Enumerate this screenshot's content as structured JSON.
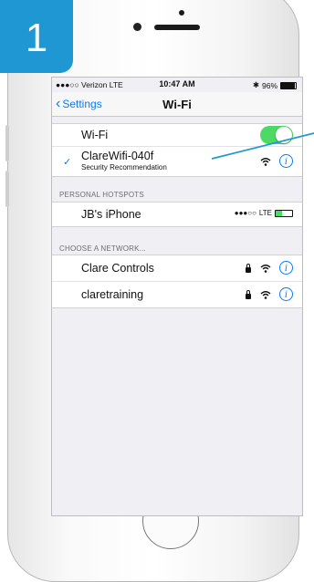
{
  "callout": {
    "step_number": "1",
    "color": "#1f97d3"
  },
  "status_bar": {
    "carrier": "●●●○○ Verizon  LTE",
    "time": "10:47 AM",
    "bluetooth": "✱",
    "battery": "96%"
  },
  "nav": {
    "back_label": "Settings",
    "title": "Wi-Fi"
  },
  "wifi_toggle": {
    "label": "Wi-Fi",
    "on": true
  },
  "connected_network": {
    "name": "ClareWifi-040f",
    "subtitle": "Security Recommendation"
  },
  "personal_hotspots": {
    "header": "PERSONAL HOTSPOTS",
    "items": [
      {
        "name": "JB's iPhone",
        "signal": "●●●○○",
        "network": "LTE"
      }
    ]
  },
  "choose_network": {
    "header": "CHOOSE A NETWORK...",
    "items": [
      {
        "name": "Clare Controls"
      },
      {
        "name": "claretraining"
      }
    ]
  },
  "icons": {
    "info": "i",
    "check": "✓",
    "wifi": "wifi-icon",
    "lock": "lock-icon"
  }
}
